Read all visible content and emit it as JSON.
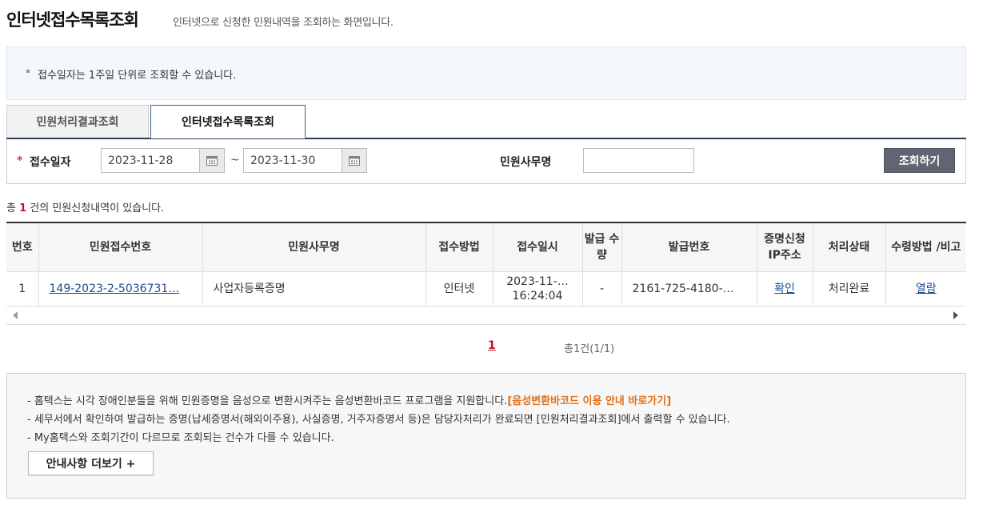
{
  "header": {
    "title": "인터넷접수목록조회",
    "description": "인터넷으로 신청한 민원내역을 조회하는 화면입니다."
  },
  "notice": {
    "text": "접수일자는 1주일 단위로 조회할 수 있습니다."
  },
  "tabs": [
    {
      "label": "민원처리결과조회",
      "active": false
    },
    {
      "label": "인터넷접수목록조회",
      "active": true
    }
  ],
  "search": {
    "required_mark": "*",
    "date_label": "접수일자",
    "date_from": "2023-11-28",
    "date_sep": "~",
    "date_to": "2023-11-30",
    "minwon_label": "민원사무명",
    "minwon_value": "",
    "button_label": "조회하기"
  },
  "summary": {
    "prefix": "총",
    "count": "1",
    "suffix": "건의 민원신청내역이 있습니다."
  },
  "table": {
    "headers": [
      "번호",
      "민원접수번호",
      "민원사무명",
      "접수방법",
      "접수일시",
      "발급 수량",
      "발급번호",
      "증명신청 IP주소",
      "처리상태",
      "수령방법 /비고"
    ],
    "rows": [
      {
        "no": "1",
        "receipt_no": "149-2023-2-5036731…",
        "service_name": "사업자등록증명",
        "method": "인터넷",
        "date_line1": "2023-11-…",
        "date_line2": "16:24:04",
        "issue_qty": "-",
        "issue_no": "2161-725-4180-…",
        "ip_check": "확인",
        "status": "처리완료",
        "receive": "열람"
      }
    ]
  },
  "pagination": {
    "current": "1",
    "total": "총1건(1/1)"
  },
  "guide": {
    "line1": "- 홈택스는 시각 장애인분들을 위해 민원증명을 음성으로 변환시켜주는 음성변환바코드 프로그램을 지원합니다.",
    "line1_link": "[음성변환바코드 이용 안내 바로가기]",
    "line2": "- 세무서에서 확인하여 발급하는 증명(납세증명서(해외이주용), 사실증명, 거주자증명서 등)은 담당자처리가 완료되면 [민원처리결과조회]에서 출력할 수 있습니다.",
    "line3": "- My홈택스와 조회기간이 다르므로 조회되는 건수가 다를 수 있습니다.",
    "more_button": "안내사항 더보기 +"
  },
  "colors": {
    "accent_red": "#c8102e",
    "link_orange": "#e0711c",
    "tab_border": "#2c3e5c",
    "search_button": "#5f6571"
  }
}
